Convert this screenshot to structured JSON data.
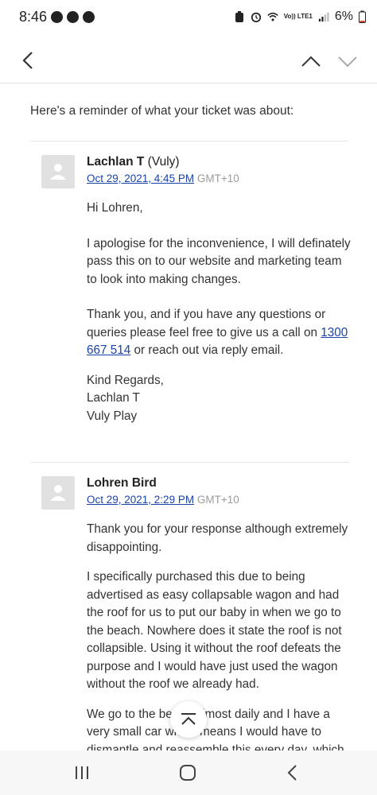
{
  "status": {
    "time": "8:46",
    "network": "Vo)) LTE1",
    "battery": "6%"
  },
  "intro": "Here's a reminder of what your ticket was about:",
  "messages": [
    {
      "sender_name": "Lachlan T",
      "sender_org": "(Vuly)",
      "date": "Oct 29, 2021, 4:45 PM",
      "tz": "GMT+10",
      "greeting": "Hi Lohren,",
      "para1": "I apologise for the inconvenience, I will definately pass this on to our website and marketing team to look into making changes.",
      "para2_before": "Thank you, and if you have any questions or queries please feel free to give us a call on ",
      "phone": "1300 667 514",
      "para2_after": " or reach out via reply email.",
      "sign1": "Kind Regards,",
      "sign2": "Lachlan T",
      "sign3": "Vuly Play"
    },
    {
      "sender_name": "Lohren Bird",
      "date": "Oct 29, 2021, 2:29 PM",
      "tz": "GMT+10",
      "para1": "Thank you for your response although extremely disappointing.",
      "para2": "I specifically purchased this due to being advertised as easy collapsable wagon and had the roof for us to put our baby in when we go to the beach. Nowhere does it state the roof is not collapsible. Using it without the roof defeats the purpose and I would have just used the wagon without the roof we already had.",
      "para3": "We go to the beach almost daily and I have a very small car which means I would have to dismantle and reassemble this every day, which will also"
    }
  ]
}
